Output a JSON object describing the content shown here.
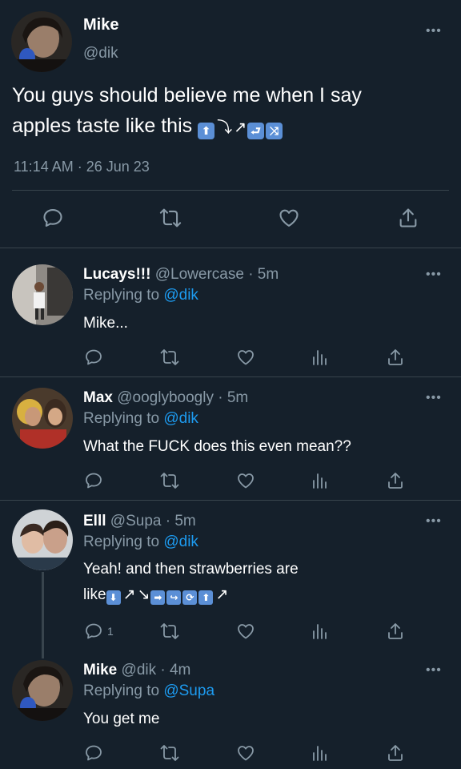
{
  "main_tweet": {
    "name": "Mike",
    "handle": "@dik",
    "text_line1": "You guys should believe me when I say",
    "text_line2": "apples taste like this",
    "timestamp": "11:14 AM · 26 Jun 23"
  },
  "replies": [
    {
      "name": "Lucays!!!",
      "handle": "@Lowercase · 5m",
      "replying_label": "Replying to",
      "replying_to": "@dik",
      "text": "Mike..."
    },
    {
      "name": "Max",
      "handle": "@ooglyboogly · 5m",
      "replying_label": "Replying to",
      "replying_to": "@dik",
      "text": "What the FUCK does this even mean??"
    },
    {
      "name": "Elll",
      "handle": "@Supa · 5m",
      "replying_label": "Replying to",
      "replying_to": "@dik",
      "text_line1": "Yeah! and then strawberries are",
      "text_line2": "like",
      "reply_count": "1"
    },
    {
      "name": "Mike",
      "handle": "@dik · 4m",
      "replying_label": "Replying to",
      "replying_to": "@Supa",
      "text": "You get me"
    }
  ],
  "colors": {
    "background": "#15202b",
    "muted": "#8899a6",
    "accent": "#1d9bf0",
    "divider": "#38444d"
  }
}
